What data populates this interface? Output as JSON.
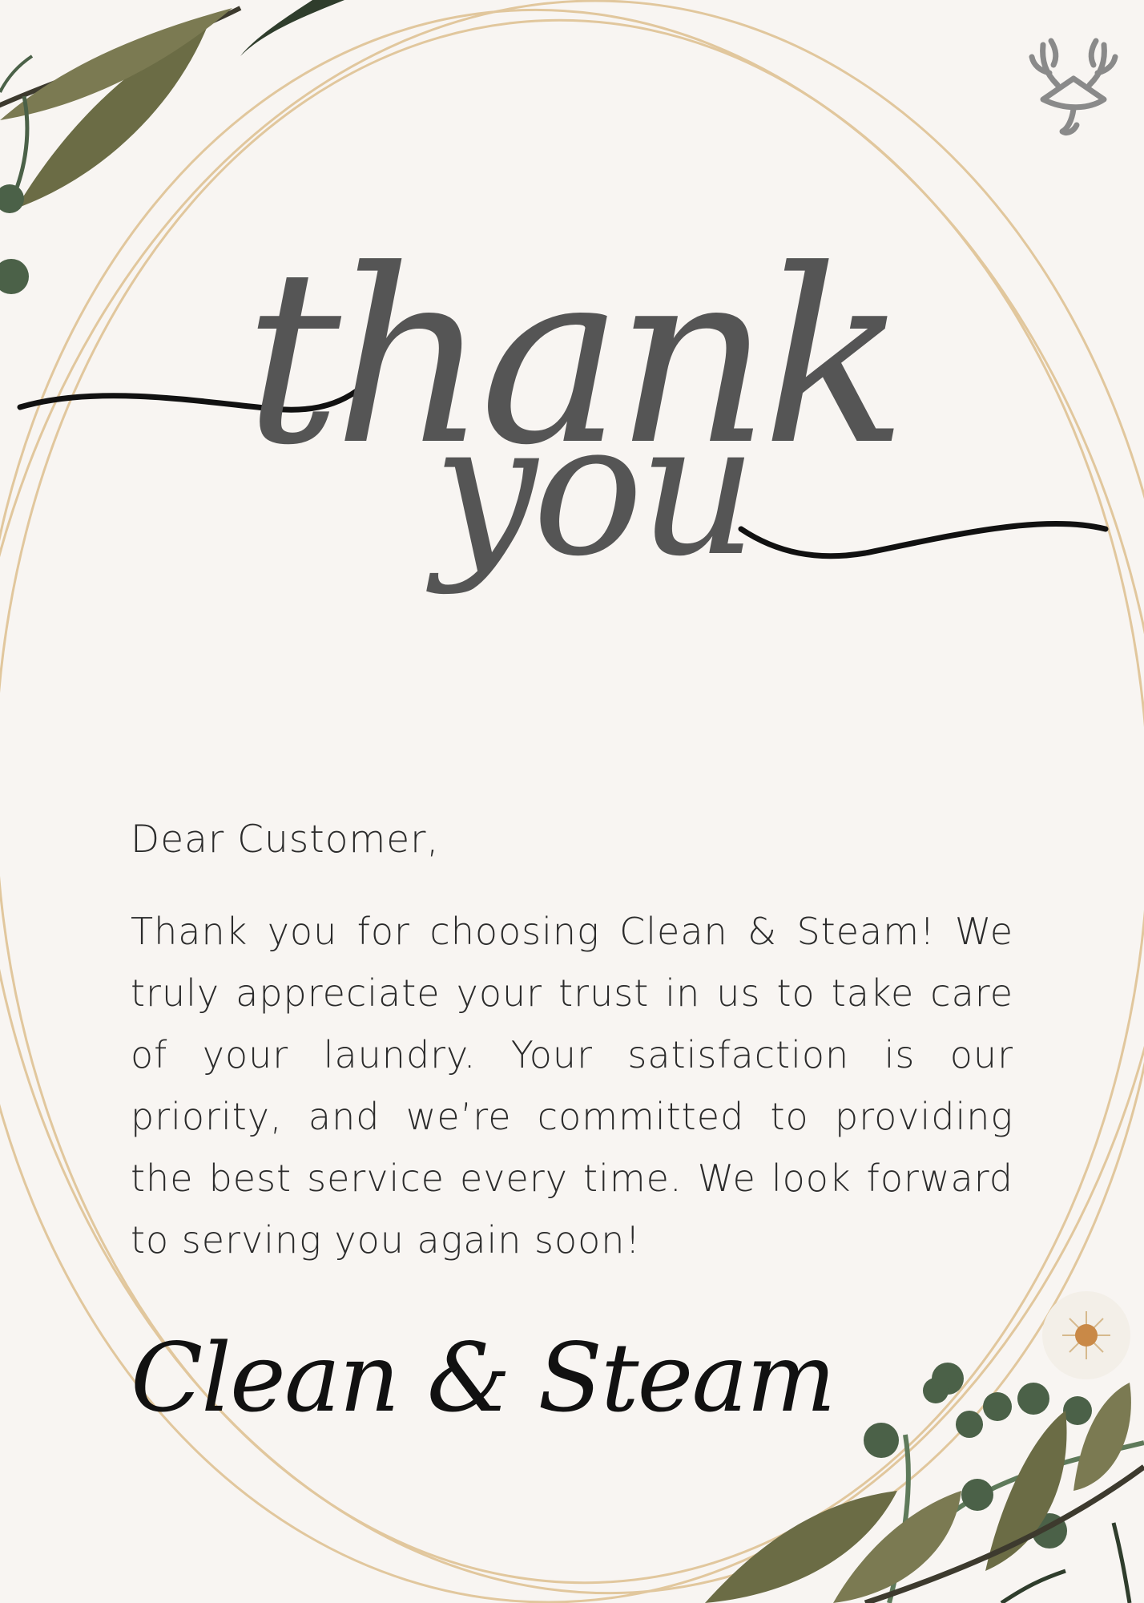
{
  "headline": {
    "line1": "thank",
    "line2": "you"
  },
  "letter": {
    "greeting": "Dear Customer,",
    "body": "Thank you for choosing Clean & Steam! We truly appreciate your trust in us to take care of your laundry. Your satisfaction is our priority, and we’re committed to providing the best service every time. We look forward to serving you again soon!"
  },
  "signature": {
    "text": "Clean & Steam"
  },
  "icons": {
    "logo": "deer-antler-icon",
    "decor_top": "leaf-branch-icon",
    "decor_bottom": "flower-branch-icon"
  },
  "colors": {
    "background": "#f8f5f2",
    "script": "#555555",
    "gold": "#e0c393",
    "leaf": "#6b6c45",
    "berry": "#4b6148"
  }
}
